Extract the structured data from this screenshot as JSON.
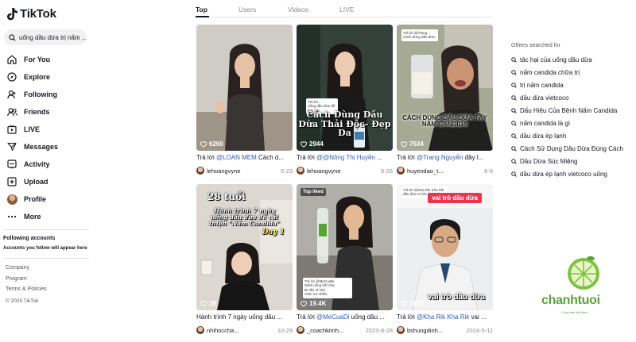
{
  "app": {
    "brand": "TikTok",
    "accent": "#fe2c55"
  },
  "search": {
    "query": "uống dầu dừa trị nấm ..."
  },
  "nav": [
    {
      "label": "For You",
      "icon": "home-icon"
    },
    {
      "label": "Explore",
      "icon": "compass-icon"
    },
    {
      "label": "Following",
      "icon": "following-icon"
    },
    {
      "label": "Friends",
      "icon": "friends-icon"
    },
    {
      "label": "LIVE",
      "icon": "live-icon"
    },
    {
      "label": "Messages",
      "icon": "messages-icon"
    },
    {
      "label": "Activity",
      "icon": "activity-icon"
    },
    {
      "label": "Upload",
      "icon": "upload-icon"
    },
    {
      "label": "Profile",
      "icon": "avatar"
    },
    {
      "label": "More",
      "icon": "more-icon"
    }
  ],
  "following_accounts": {
    "title": "Following accounts",
    "subtitle": "Accounts you follow will appear here"
  },
  "footer": {
    "links": [
      "Company",
      "Program",
      "Terms & Policies"
    ],
    "copyright": "© 2025 TikTok"
  },
  "tabs": [
    "Top",
    "Users",
    "Videos",
    "LIVE"
  ],
  "active_tab": "Top",
  "videos": [
    {
      "views": "6260",
      "caption_prefix": "Trả lời ",
      "mention": "@LOAN MEM",
      "caption_rest": " Cách d...",
      "user": "lehoangvyne",
      "date": "5-23"
    },
    {
      "views": "2944",
      "caption_prefix": "Trả lời ",
      "mention": "@@Nông Thị Huyền",
      "caption_rest": " ...",
      "user": "lehoangvyne",
      "date": "6-26",
      "overlay": "Cách Dùng Dầu Dừa Thải Độc- Đẹp Da"
    },
    {
      "views": "7634",
      "caption_prefix": "Trả lời ",
      "mention": "@Trang Nguyễn",
      "caption_rest": " đây l...",
      "user": "huyendao_t...",
      "date": "6-6",
      "overlay": "CÁCH DÙNG DẦU DỪA TẨY NẤM CANDIDA"
    },
    {
      "views": "39",
      "caption_prefix": "Hành trình 7 ngày uống dầu ...",
      "mention": "",
      "caption_rest": "",
      "user": "nhihoccha...",
      "date": "10-29",
      "overlay_top": "28 tuổi",
      "overlay": "Hành trình 7 ngày uống dầu dừa để cải thiện \"Nấm Candida\"",
      "overlay_day": "Day 1"
    },
    {
      "views": "19.4K",
      "caption_prefix": "Trả lời ",
      "mention": "@MeCuaDi",
      "caption_rest": " uống dầu ...",
      "user": "_coachkimh...",
      "date": "2023-8-28",
      "badge": "Top liked"
    },
    {
      "views": "1572",
      "caption_prefix": "Trả lời ",
      "mention": "@Kha Rik Kha Rik",
      "caption_rest": " vai ...",
      "user": "bshungdinh...",
      "date": "2024-5-11",
      "tag": "vai trò dầu dừa",
      "subtitle": "vai trò dầu dừa"
    }
  ],
  "others_searched": {
    "title": "Others searched for",
    "items": [
      "tác hại của uống dầu dừa",
      "nấm candida chữa trị",
      "trị nấm candida",
      "dầu dừa vietcoco",
      "Dấu Hiệu Của Bệnh Nấm Candida",
      "nấm candida là gì",
      "dầu dừa ép lạnh",
      "Cách Sử Dụng Dầu Dừa Đúng Cách",
      "Dầu Dừa Súc Miệng",
      "dầu dừa ép lạnh vietcoco uống"
    ]
  },
  "watermark": {
    "brand": "chanhtuoi",
    "slogan": "Cùng bạn tiết kiệm"
  }
}
